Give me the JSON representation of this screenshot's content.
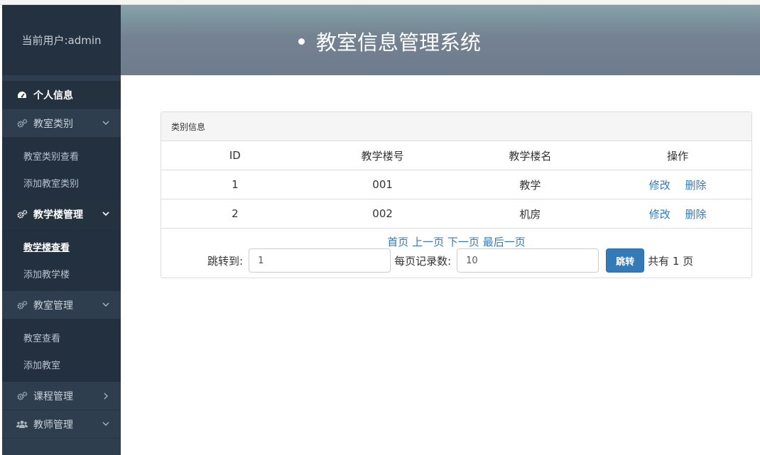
{
  "sidebar": {
    "current_user": "当前用户:admin",
    "personal_info": "个人信息",
    "groups": [
      {
        "label": "教室类别",
        "items": [
          "教室类别查看",
          "添加教室类别"
        ]
      },
      {
        "label": "教学楼管理",
        "items": [
          "教学楼查看",
          "添加教学楼"
        ]
      },
      {
        "label": "教室管理",
        "items": [
          "教室查看",
          "添加教室"
        ]
      },
      {
        "label": "课程管理"
      },
      {
        "label": "教师管理"
      }
    ]
  },
  "header": {
    "title": "教室信息管理系统"
  },
  "panel": {
    "heading": "类别信息",
    "columns": [
      "ID",
      "教学楼号",
      "教学楼名",
      "操作"
    ],
    "rows": [
      {
        "id": "1",
        "number": "001",
        "name": "教学",
        "edit": "修改",
        "delete": "删除"
      },
      {
        "id": "2",
        "number": "002",
        "name": "机房",
        "edit": "修改",
        "delete": "删除"
      }
    ]
  },
  "pager": {
    "first": "首页",
    "prev": "上一页",
    "next": "下一页",
    "last": "最后一页",
    "jump_label": "跳转到:",
    "jump_value": "1",
    "per_page_label": "每页记录数:",
    "per_page_value": "10",
    "jump_button": "跳转",
    "total": "共有 1 页"
  },
  "colors": {
    "sidebar": "#2e3e4e",
    "link": "#337ab7",
    "button": "#337ab7"
  },
  "icons": [
    "dashboard-icon",
    "gears-icon",
    "users-icon",
    "chevron-down-icon",
    "chevron-right-icon"
  ]
}
